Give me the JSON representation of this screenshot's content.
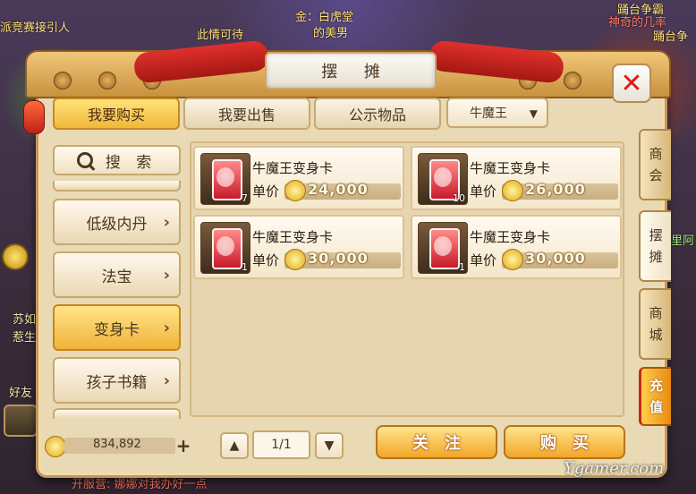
{
  "window": {
    "title": "摆 摊",
    "close_icon": "close-icon"
  },
  "background_text": {
    "top_left": "派竞赛接引人",
    "top_mid": "金：白虎堂",
    "top_mid2": "此情可待",
    "top_mid3": "的美男",
    "top_right1": "踊台争霸",
    "top_right2": "神奇的几率",
    "top_right3": "踊台争",
    "left_mid1": "苏如",
    "left_mid2": "惹生",
    "left_mid3": "好友",
    "bottom_left": "开服营: 娜娜对我办好一点",
    "right_mid": "里阿"
  },
  "tabs": [
    {
      "label": "我要购买",
      "active": true
    },
    {
      "label": "我要出售",
      "active": false
    },
    {
      "label": "公示物品",
      "active": false
    }
  ],
  "filter": {
    "selected": "牛魔王",
    "caret": "▼"
  },
  "search": {
    "label": "搜 索"
  },
  "categories": [
    {
      "label": "低级内丹",
      "active": false
    },
    {
      "label": "法宝",
      "active": false
    },
    {
      "label": "变身卡",
      "active": true
    },
    {
      "label": "孩子书籍",
      "active": false
    }
  ],
  "listings": [
    {
      "name": "牛魔王变身卡",
      "price_label": "单价",
      "price": "24,000",
      "qty": "7"
    },
    {
      "name": "牛魔王变身卡",
      "price_label": "单价",
      "price": "26,000",
      "qty": "10"
    },
    {
      "name": "牛魔王变身卡",
      "price_label": "单价",
      "price": "30,000",
      "qty": "1"
    },
    {
      "name": "牛魔王变身卡",
      "price_label": "单价",
      "price": "30,000",
      "qty": "1"
    }
  ],
  "side_tabs": [
    {
      "label": "商会",
      "chars": [
        "商",
        "会"
      ]
    },
    {
      "label": "摆摊",
      "chars": [
        "摆",
        "摊"
      ]
    },
    {
      "label": "商城",
      "chars": [
        "商",
        "城"
      ]
    },
    {
      "label": "充值",
      "chars": [
        "充",
        "值"
      ]
    }
  ],
  "footer": {
    "money": "834,892",
    "plus": "+",
    "page": "1/1",
    "prev": "▲",
    "next": "▼",
    "follow_label": "关注",
    "buy_label": "购买"
  },
  "watermark": "Ygamer.com",
  "colors": {
    "accent": "#f0b838",
    "panel": "#e9d9b4",
    "close": "#d81f1a",
    "ribbon": "#d12a22"
  }
}
